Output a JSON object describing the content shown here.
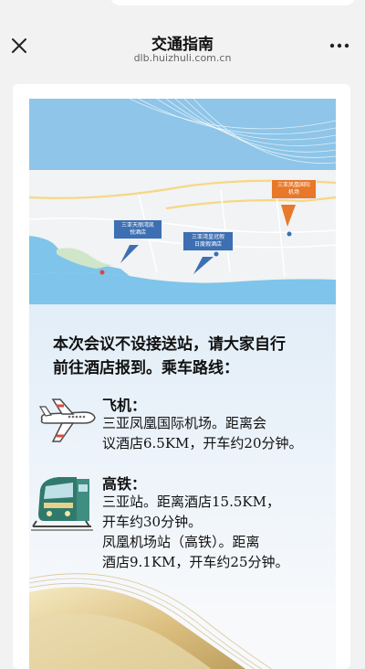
{
  "nav": {
    "title": "交通指南",
    "domain": "dlb.huizhuli.com.cn"
  },
  "map": {
    "callouts": [
      {
        "text1": "三亚天丽湾凯",
        "text2": "悦酒店",
        "color": "#3d6fb2"
      },
      {
        "text1": "三亚湾皇冠假",
        "text2": "日度假酒店",
        "color": "#3d6fb2"
      },
      {
        "text1": "三亚凤凰国际",
        "text2": "机场",
        "color": "#e8782a"
      }
    ]
  },
  "intro": {
    "line1": "本次会议不设接送站，请大家自行",
    "line2": "前往酒店报到。乘车路线："
  },
  "plane": {
    "icon": "airplane-icon",
    "title": "飞机：",
    "line1": "三亚凤凰国际机场。距离会",
    "line2": "议酒店6.5KM，开车约20分钟。"
  },
  "train": {
    "icon": "train-icon",
    "title": "高铁：",
    "line1": "三亚站。距离酒店15.5KM，",
    "line2": "开车约30分钟。",
    "line3": "凤凰机场站（高铁）。距离",
    "line4": "酒店9.1KM，开车约25分钟。"
  }
}
